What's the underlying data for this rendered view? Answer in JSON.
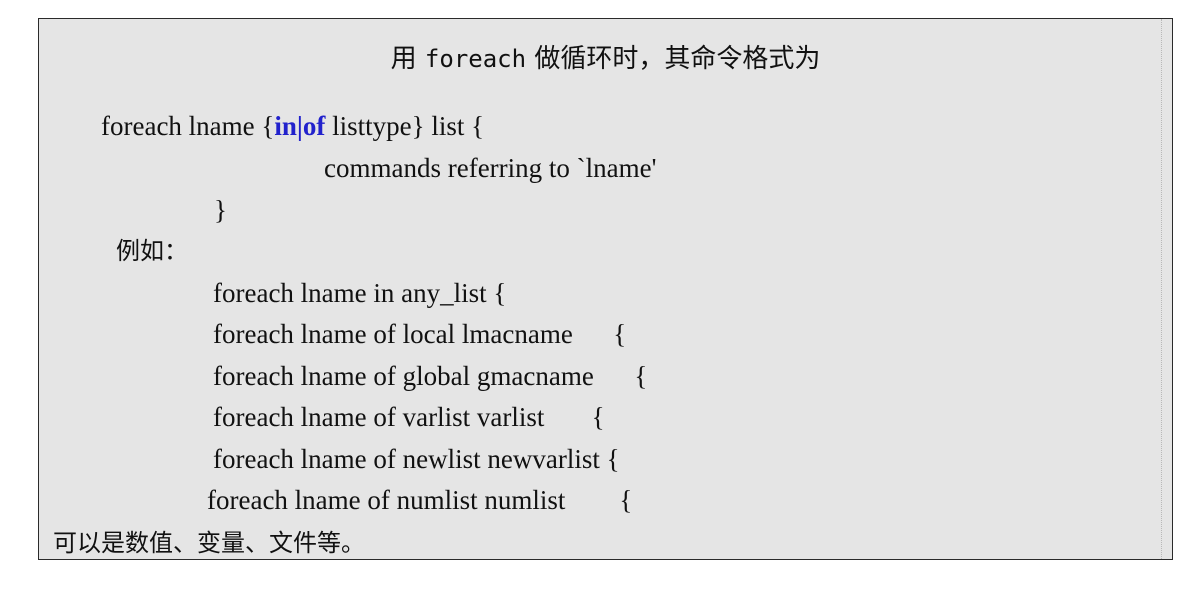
{
  "title": {
    "prefix": "用 ",
    "code": "foreach",
    "suffix": " 做循环时，其命令格式为"
  },
  "syntax": {
    "line1_start": "foreach lname {",
    "kw_in": "in",
    "kw_sep": "|",
    "kw_of": "of",
    "line1_end": " listtype} list {",
    "line2": "commands referring to `lname'",
    "line3": "}"
  },
  "example_label": "例如：",
  "examples": [
    "foreach lname in any_list {",
    "foreach lname of local lmacname      {",
    "foreach lname of global gmacname      {",
    "foreach lname of varlist varlist       {",
    "foreach lname of newlist newvarlist {",
    "foreach lname of numlist numlist        {"
  ],
  "note": "可以是数值、变量、文件等。",
  "colors": {
    "background": "#e5e5e5",
    "keyword": "#2222cc",
    "border": "#2a2a2a"
  }
}
